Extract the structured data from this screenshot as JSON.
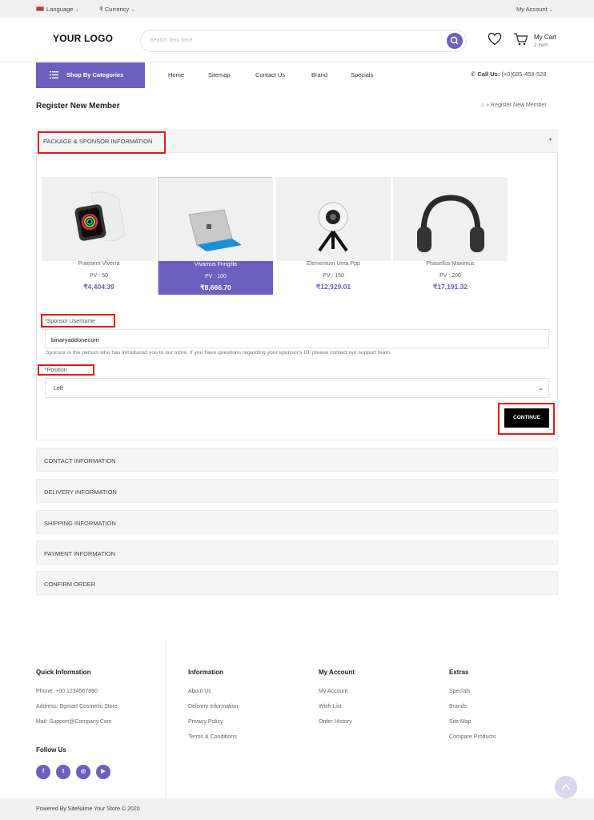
{
  "topbar": {
    "language": "Language",
    "currency": "Currency",
    "my_account": "My Account"
  },
  "header": {
    "logo": "YOUR LOGO",
    "search_placeholder": "Search item here",
    "cart_title": "My Cart",
    "cart_count": "2 item"
  },
  "nav": {
    "categories": "Shop By Categories",
    "items": [
      "Home",
      "Sitemap",
      "Contact Us",
      "Brand",
      "Specials"
    ],
    "call_label": "Call Us:",
    "call_number": "(+0)685-459-528"
  },
  "page": {
    "title": "Register New Member",
    "breadcrumb": "» Register New Member"
  },
  "package_panel": {
    "title": "PACKAGE & SPONSOR INFORMATION",
    "products": [
      {
        "name": "Praesent Viverra",
        "pv": "PV : 50",
        "price": "₹4,404.39",
        "selected": false
      },
      {
        "name": "Vivamus Fringilla",
        "pv": "PV : 100",
        "price": "₹8,666.70",
        "selected": true
      },
      {
        "name": "Elementum Urna Ppp",
        "pv": "PV : 150",
        "price": "₹12,929.01",
        "selected": false
      },
      {
        "name": "Phasellus Maximus",
        "pv": "PV : 200",
        "price": "₹17,191.32",
        "selected": false
      }
    ],
    "sponsor_label": "Sponsor Username",
    "sponsor_value": "binaryaddonecom",
    "sponsor_help": "Sponsor is the person who has introduced you to our store. If you have questions regarding your sponsor's ID, please contact our support team.",
    "position_label": "Position",
    "position_value": "Left",
    "continue": "CONTINUE",
    "required_mark": "*"
  },
  "sections": [
    "CONTACT INFORMATION",
    "DELIVERY INFORMATION",
    "SHIPPING INFORMATION",
    "PAYMENT INFORMATION",
    "CONFIRM ORDER"
  ],
  "footer": {
    "quick_title": "Quick Information",
    "phone": "Phone:  +00 1234567890",
    "address": "Address:  Bgmart Cosmetic Store.",
    "mail": "Mail:  Support@Company.Com",
    "follow": "Follow Us",
    "social": [
      "f",
      "t",
      "◎",
      "▶"
    ],
    "information": {
      "title": "Information",
      "links": [
        "About Us",
        "Delivery Information",
        "Privacy Policy",
        "Terms & Conditions"
      ]
    },
    "account": {
      "title": "My Account",
      "links": [
        "My Account",
        "Wish List",
        "Order History"
      ]
    },
    "extras": {
      "title": "Extras",
      "links": [
        "Specials",
        "Brands",
        "Site Map",
        "Compare Products"
      ]
    },
    "copyright": "Powered By SiteName Your Store © 2020"
  },
  "colors": {
    "accent": "#6c5fbd",
    "highlight": "#e01b1b"
  }
}
